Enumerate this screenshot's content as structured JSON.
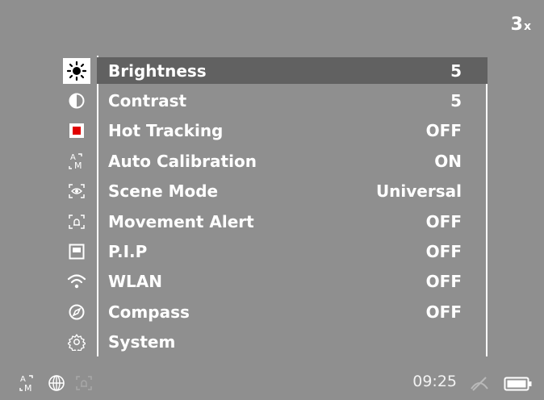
{
  "zoom": {
    "value": "3",
    "suffix": "x"
  },
  "menu": [
    {
      "icon": "brightness-icon",
      "label": "Brightness",
      "value": "5",
      "selected": true
    },
    {
      "icon": "contrast-icon",
      "label": "Contrast",
      "value": "5"
    },
    {
      "icon": "hot-tracking-icon",
      "label": "Hot Tracking",
      "value": "OFF"
    },
    {
      "icon": "auto-calibration-icon",
      "label": "Auto Calibration",
      "value": "ON"
    },
    {
      "icon": "scene-mode-icon",
      "label": "Scene Mode",
      "value": "Universal"
    },
    {
      "icon": "movement-alert-icon",
      "label": "Movement Alert",
      "value": "OFF"
    },
    {
      "icon": "pip-icon",
      "label": "P.I.P",
      "value": "OFF"
    },
    {
      "icon": "wlan-icon",
      "label": "WLAN",
      "value": "OFF"
    },
    {
      "icon": "compass-icon",
      "label": "Compass",
      "value": "OFF"
    },
    {
      "icon": "system-icon",
      "label": "System",
      "value": ""
    }
  ],
  "status": {
    "time": "09:25",
    "icons": [
      "auto-calibration-status-icon",
      "globe-icon",
      "movement-alert-status-icon",
      "no-signal-icon",
      "battery-icon"
    ]
  },
  "colors": {
    "background": "#8f8f8f",
    "selected_band": "#616161",
    "hot_tracking": "#e00000"
  }
}
